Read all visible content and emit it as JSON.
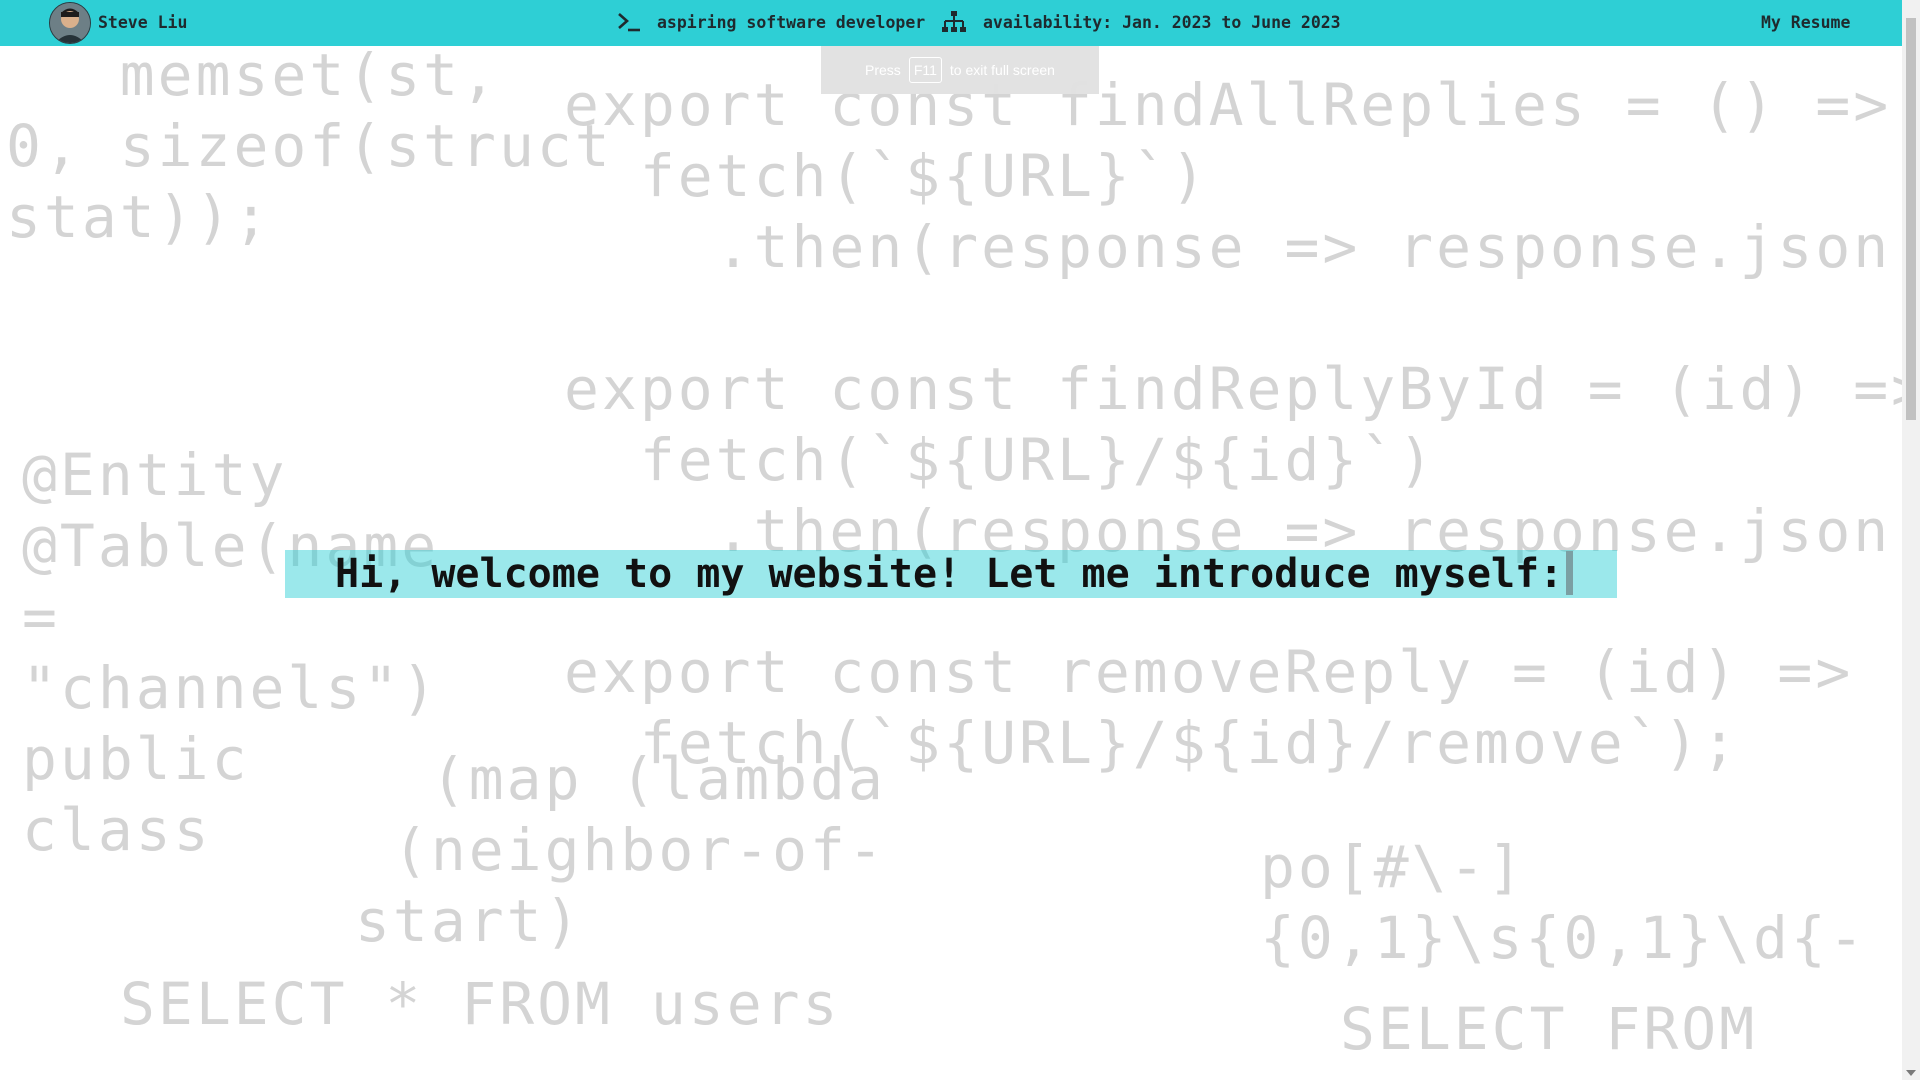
{
  "header": {
    "name": "Steve Liu",
    "role": "aspiring software developer",
    "availability": "availability: Jan. 2023 to June 2023",
    "resume_link": "My Resume",
    "accent_color": "#2ecfd5"
  },
  "fullscreen_notice": {
    "prefix": "Press",
    "key": "F11",
    "suffix": "to exit full screen"
  },
  "welcome": {
    "message": "Hi, welcome to my website! Let me introduce myself:"
  },
  "background_code": {
    "c_memset": "   memset(st,\n0, sizeof(struct\nstat));",
    "js_findall": "export const findAllReplies = () =>\n  fetch(`${URL}`)\n    .then(response => response.json(",
    "js_findbyid": "export const findReplyById = (id) =>\n  fetch(`${URL}/${id}`)\n    .then(response => response.json(",
    "js_remove": "export const removeReply = (id) =>\n  fetch(`${URL}/${id}/remove`);",
    "java_entity": "@Entity\n@Table(name\n=\n\"channels\")\npublic\nclass",
    "lisp_map": "  (map (lambda\n (neighbor-of-\nstart)",
    "regex": "po[#\\-]\n{0,1}\\s{0,1}\\d{-",
    "sql_select": "SELECT * FROM users",
    "sql_select2": "SELECT FROM"
  },
  "icons": {
    "terminal": "terminal-icon",
    "sitemap": "sitemap-icon",
    "avatar": "avatar"
  }
}
